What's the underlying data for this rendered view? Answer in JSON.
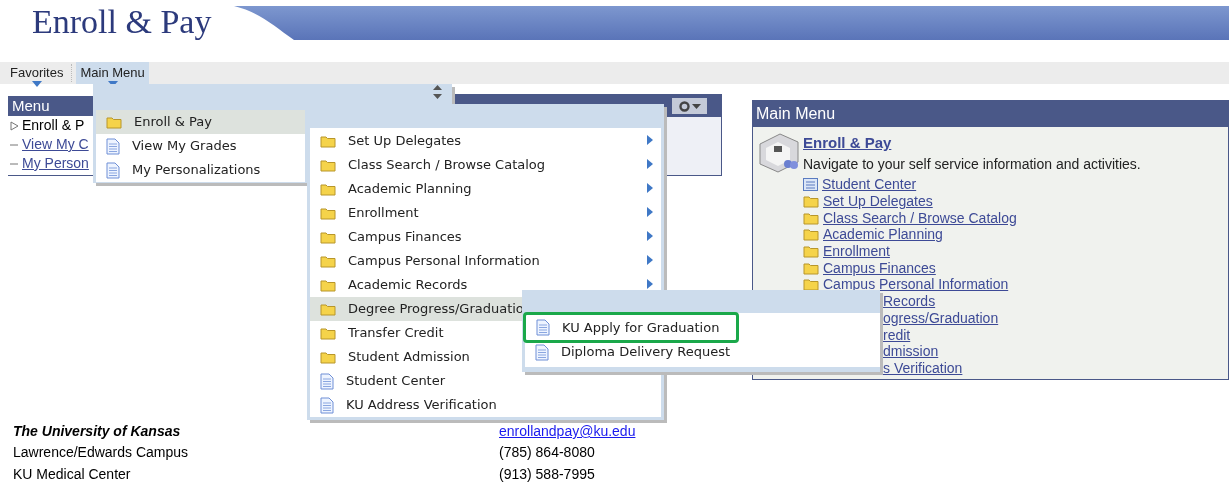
{
  "header": {
    "title": "Enroll & Pay"
  },
  "nav": [
    {
      "label": "Favorites",
      "selected": false
    },
    {
      "label": "Main Menu",
      "selected": true
    }
  ],
  "menu_pagelet": {
    "title": "Menu",
    "items": [
      {
        "kind": "folder",
        "label": "Enroll & P"
      },
      {
        "kind": "link",
        "label": "View My C"
      },
      {
        "kind": "link",
        "label": "My Person"
      }
    ]
  },
  "main_menu_pagelet": {
    "title": "Main Menu",
    "heading": "Enroll & Pay",
    "description": "Navigate to your self service information and activities.",
    "items": [
      {
        "kind": "center",
        "label": "Student Center"
      },
      {
        "kind": "folder",
        "label": "Set Up Delegates"
      },
      {
        "kind": "folder",
        "label": "Class Search / Browse Catalog"
      },
      {
        "kind": "folder",
        "label": "Academic Planning"
      },
      {
        "kind": "folder",
        "label": "Enrollment"
      },
      {
        "kind": "folder",
        "label": "Campus Finances"
      },
      {
        "kind": "folder",
        "label": "Campus Personal Information"
      },
      {
        "kind": "covered",
        "label": "Records"
      },
      {
        "kind": "covered",
        "label": "ogress/Graduation"
      },
      {
        "kind": "covered",
        "label": "redit"
      },
      {
        "kind": "covered",
        "label": "dmission"
      },
      {
        "kind": "covered",
        "label": "s Verification"
      }
    ]
  },
  "dropdown": {
    "items": [
      {
        "kind": "folder",
        "label": "Enroll & Pay",
        "selected": true
      },
      {
        "kind": "page",
        "label": "View My Grades",
        "selected": false
      },
      {
        "kind": "page",
        "label": "My Personalizations",
        "selected": false
      }
    ]
  },
  "submenu": {
    "items": [
      {
        "kind": "folder",
        "label": "Set Up Delegates",
        "has_children": true,
        "selected": false
      },
      {
        "kind": "folder",
        "label": "Class Search / Browse Catalog",
        "has_children": true,
        "selected": false
      },
      {
        "kind": "folder",
        "label": "Academic Planning",
        "has_children": true,
        "selected": false
      },
      {
        "kind": "folder",
        "label": "Enrollment",
        "has_children": true,
        "selected": false
      },
      {
        "kind": "folder",
        "label": "Campus Finances",
        "has_children": true,
        "selected": false
      },
      {
        "kind": "folder",
        "label": "Campus Personal Information",
        "has_children": true,
        "selected": false
      },
      {
        "kind": "folder",
        "label": "Academic Records",
        "has_children": true,
        "selected": false
      },
      {
        "kind": "folder",
        "label": "Degree Progress/Graduatio",
        "selected": true
      },
      {
        "kind": "folder",
        "label": "Transfer Credit",
        "selected": false
      },
      {
        "kind": "folder",
        "label": "Student Admission",
        "selected": false
      },
      {
        "kind": "page",
        "label": "Student Center",
        "has_children": false,
        "selected": false
      },
      {
        "kind": "page",
        "label": "KU Address Verification",
        "has_children": false,
        "selected": false
      }
    ]
  },
  "submenu_2": {
    "items": [
      {
        "kind": "page",
        "label": "KU Apply for Graduation",
        "highlighted": true
      },
      {
        "kind": "page",
        "label": "Diploma Delivery Request",
        "highlighted": false
      }
    ]
  },
  "footer": {
    "name": "The University of Kansas",
    "email": "enrollandpay@ku.edu",
    "rows": [
      {
        "label": "Lawrence/Edwards Campus",
        "phone": "(785) 864-8080"
      },
      {
        "label": "KU Medical Center",
        "phone": "(913) 588-7995"
      }
    ]
  }
}
